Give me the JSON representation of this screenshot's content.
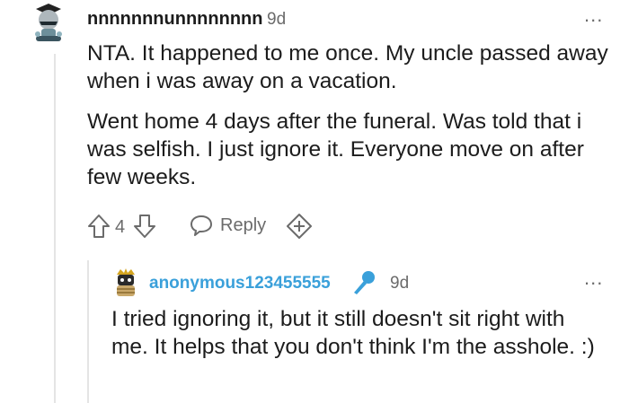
{
  "comment": {
    "username": "nnnnnnnunnnnnnnn",
    "time": "9d",
    "paragraphs": [
      "NTA. It happened to me once. My uncle passed away when i was away on a vacation.",
      "Went home 4 days after the funeral. Was told that i was selfish. I just ignore it. Everyone move on after few weeks."
    ],
    "vote_count": "4",
    "reply_label": "Reply",
    "more_label": "..."
  },
  "reply": {
    "username": "anonymous123455555",
    "time": "9d",
    "text": "I tried ignoring it, but it still doesn't sit right with me. It helps that you don't think I'm the asshole. :)",
    "more_label": "..."
  },
  "colors": {
    "op_accent": "#3aa0da",
    "text": "#1c1c1c",
    "muted": "#6b6b6b"
  },
  "icons": [
    "avatar",
    "upvote-icon",
    "downvote-icon",
    "chat-bubble-icon",
    "award-icon",
    "more-icon",
    "microphone-icon"
  ]
}
